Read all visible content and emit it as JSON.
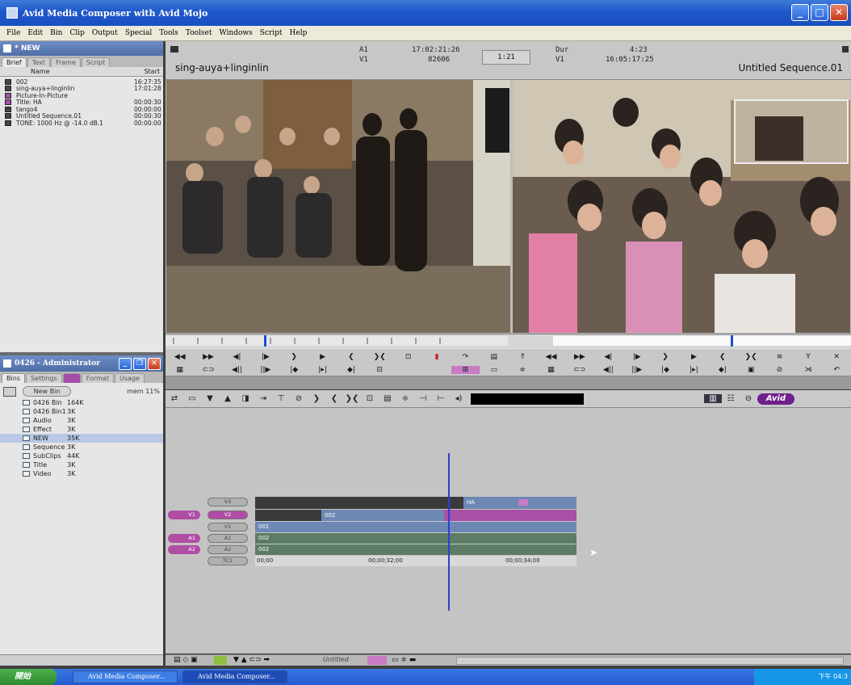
{
  "window": {
    "title": "Avid Media Composer with Avid Mojo"
  },
  "menu": [
    "File",
    "Edit",
    "Bin",
    "Clip",
    "Output",
    "Special",
    "Tools",
    "Toolset",
    "Windows",
    "Script",
    "Help"
  ],
  "bin_new": {
    "title": "* NEW",
    "tabs": [
      "Brief",
      "Text",
      "Frame",
      "Script"
    ],
    "col_name": "Name",
    "col_start": "Start",
    "rows": [
      {
        "name": "002",
        "start": "16:27:35"
      },
      {
        "name": "sing-auya+linginlin",
        "start": "17:01:28"
      },
      {
        "name": "Picture-In-Picture",
        "start": ""
      },
      {
        "name": "Title: HA",
        "start": "00:00:30"
      },
      {
        "name": "tango4",
        "start": "00:00:00"
      },
      {
        "name": "Untitled Sequence.01",
        "start": "00:00:30"
      },
      {
        "name": "TONE: 1000 Hz @ -14.0 dB.1",
        "start": "00:00:00"
      }
    ]
  },
  "project": {
    "title": "0426 - Administrator",
    "tabs": [
      "Bins",
      "Settings",
      "",
      "Format",
      "Usage"
    ],
    "new_bin": "New Bin",
    "mem": "mem 11%",
    "bins": [
      {
        "name": "0426 Bin",
        "size": "164K"
      },
      {
        "name": "0426 Bin1",
        "size": "3K"
      },
      {
        "name": "Audio",
        "size": "3K"
      },
      {
        "name": "Effect",
        "size": "3K"
      },
      {
        "name": "NEW",
        "size": "35K"
      },
      {
        "name": "Sequence",
        "size": "3K"
      },
      {
        "name": "SubClips",
        "size": "44K"
      },
      {
        "name": "Title",
        "size": "3K"
      },
      {
        "name": "Video",
        "size": "3K"
      }
    ]
  },
  "composer": {
    "source_name": "sing-auya+linginlin",
    "src_track_a": "A1",
    "src_track_v": "V1",
    "src_tc": "17:02:21:26",
    "src_frames": "82606",
    "center": "1:21",
    "dur_label": "Dur",
    "rec_track": "V1",
    "dur_value": "4:23",
    "rec_tc": "16:05:17:25",
    "record_name": "Untitled Sequence.01"
  },
  "timeline": {
    "tracks": [
      "V3",
      "V2",
      "V1",
      "A1",
      "A2",
      "TC1"
    ],
    "patch_v": "V1",
    "patch_a1": "A1",
    "patch_a2": "A2",
    "clip_ha": "HA",
    "clip_002_v2": "002",
    "clip_001": "001",
    "clip_002_a1": "002",
    "clip_002_a2": "002",
    "tc_start": "00;00",
    "tc_mid": "00;00;32;00",
    "tc_end": "00;00;34;00",
    "bottom_name": "Untitled",
    "avid_logo": "Avid"
  },
  "taskbar": {
    "start": "開始",
    "items": [
      "Avid Media Composer...",
      "Avid Media Composer..."
    ],
    "clock": "下午 04:3"
  }
}
